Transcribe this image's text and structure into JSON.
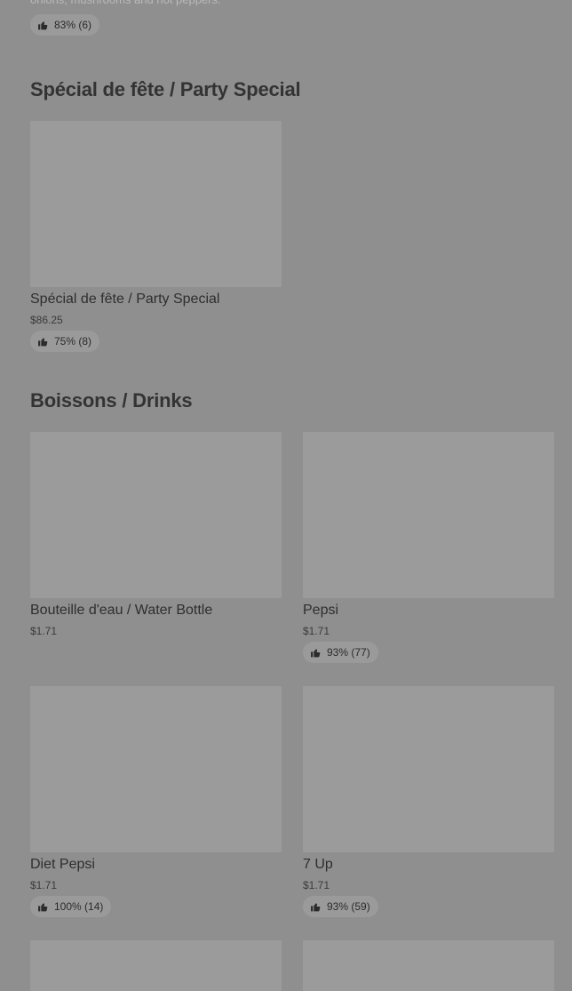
{
  "prev_item": {
    "description_tail": "onions, mushrooms and hot peppers.",
    "rating": "83% (6)"
  },
  "sections": [
    {
      "title": "Spécial de fête / Party Special",
      "items": [
        {
          "name": "Spécial de fête / Party Special",
          "price": "$86.25",
          "rating": "75% (8)"
        }
      ]
    },
    {
      "title": "Boissons / Drinks",
      "items": [
        {
          "name": "Bouteille d'eau / Water Bottle",
          "price": "$1.71",
          "rating": ""
        },
        {
          "name": "Pepsi",
          "price": "$1.71",
          "rating": "93% (77)"
        },
        {
          "name": "Diet Pepsi",
          "price": "$1.71",
          "rating": "100% (14)"
        },
        {
          "name": "7 Up",
          "price": "$1.71",
          "rating": "93% (59)"
        }
      ]
    }
  ],
  "icons": {
    "rating": "thumbs-up-icon"
  }
}
